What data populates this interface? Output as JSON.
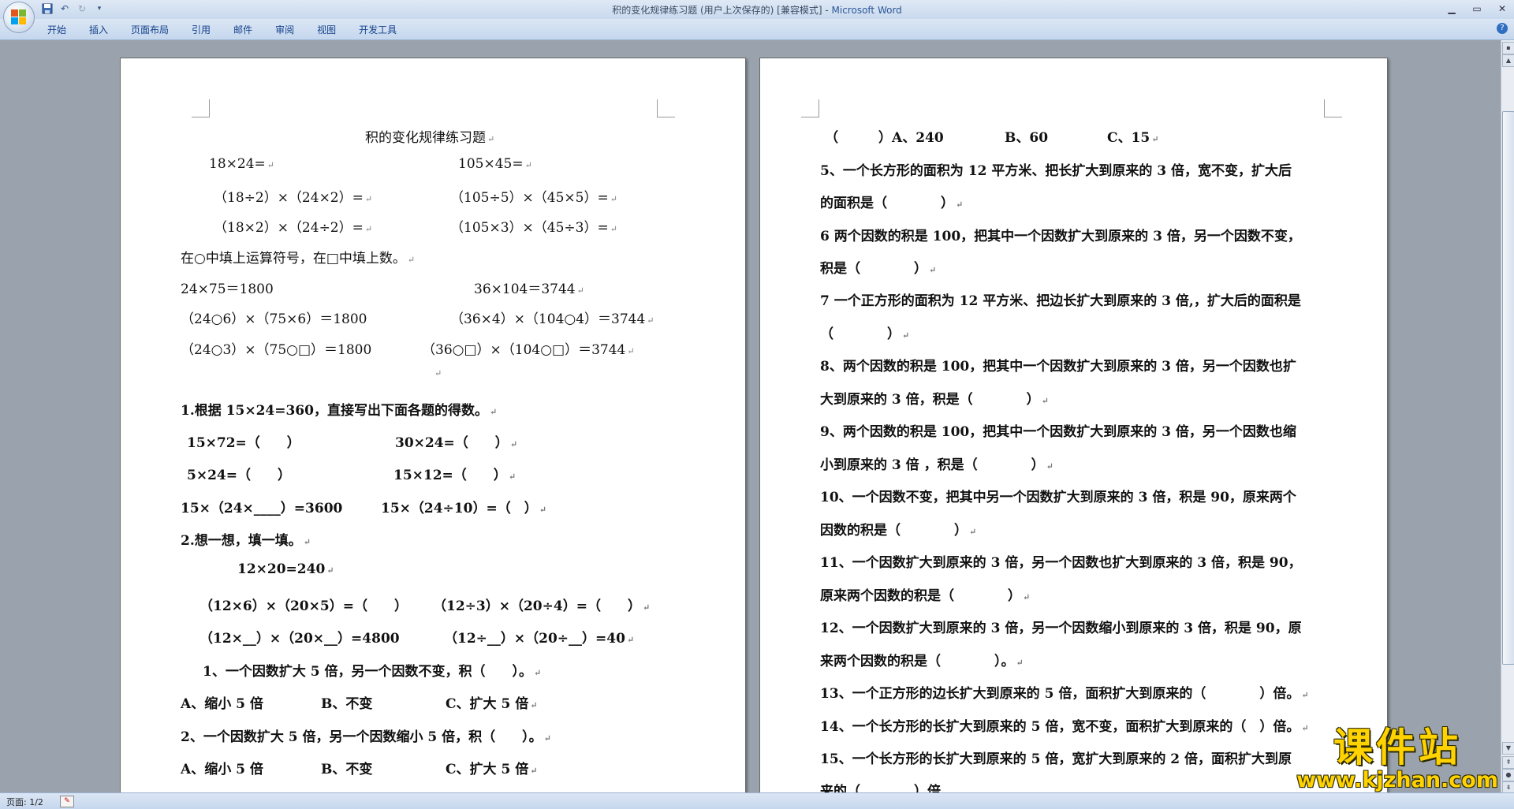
{
  "window": {
    "title": "积的变化规律练习题 (用户上次保存的) [兼容模式] - ",
    "app_name": "Microsoft Word"
  },
  "ribbon": {
    "tabs": [
      "开始",
      "插入",
      "页面布局",
      "引用",
      "邮件",
      "审阅",
      "视图",
      "开发工具"
    ]
  },
  "status": {
    "page": "页面: 1/2"
  },
  "watermark": {
    "title": "课件站",
    "url": "www.kjzhan.com"
  },
  "left_page": {
    "heading": "积的变化规律练习题",
    "line_a1": "18×24=",
    "line_a2": "105×45=",
    "line_b1": "（18÷2）×（24×2）=",
    "line_b2": "（105÷5）×（45×5）=",
    "line_c1": "（18×2）×（24÷2）=",
    "line_c2": "（105×3）×（45÷3）=",
    "instr": "在○中填上运算符号，在□中填上数。",
    "line_d1": "24×75＝1800",
    "line_d2": "36×104＝3744",
    "line_e1": "（24○6）×（75×6）＝1800",
    "line_e2": "（36×4）×（104○4）＝3744",
    "line_f1": "（24○3）×（75○□）＝1800",
    "line_f2": "（36○□）×（104○□）＝3744",
    "q1": "1.根据 15×24=360，直接写出下面各题的得数。",
    "q1a": "15×72=（　　）",
    "q1b": "30×24=（　　）",
    "q1c": "5×24=（　　）",
    "q1d": "15×12=（　　）",
    "q1e": "15×（24×____）=3600",
    "q1f": "15×（24÷10）=（　）",
    "q2": "2.想一想，填一填。",
    "q2a": "12×20=240",
    "q2b": "（12×6）×（20×5）=（　　）",
    "q2c": "（12÷3）×（20÷4）=（　　）",
    "q2d": "（12×__）×（20×__）=4800",
    "q2e": "（12÷__）×（20÷__）=40",
    "q3": "1、一个因数扩大 5 倍，另一个因数不变，积（　　）。",
    "q3A": "A、缩小 5 倍",
    "q3B": "B、不变",
    "q3C": "C、扩大 5 倍",
    "q4": "2、一个因数扩大 5 倍，另一个因数缩小 5 倍，积（　　）。",
    "q4A": "A、缩小 5 倍",
    "q4B": "B、不变",
    "q4C": "C、扩大 5 倍"
  },
  "right_page": {
    "r0a": "（　　　）A、240",
    "r0b": "B、60",
    "r0c": "C、15",
    "r5a": "5、一个长方形的面积为 12 平方米、把长扩大到原来的 3 倍，宽不变，扩大后",
    "r5b": "的面积是（　　　　）",
    "r6a": "6 两个因数的积是 100，把其中一个因数扩大到原来的 3 倍，另一个因数不变，",
    "r6b": "积是（　　　　）",
    "r7a": "7 一个正方形的面积为 12 平方米、把边长扩大到原来的 3 倍,，扩大后的面积是",
    "r7b": "（　　　　）",
    "r8a": "8、两个因数的积是 100，把其中一个因数扩大到原来的 3 倍，另一个因数也扩",
    "r8b": "大到原来的 3 倍，积是（　　　　）",
    "r9a": "9、两个因数的积是 100，把其中一个因数扩大到原来的 3 倍，另一个因数也缩",
    "r9b": "小到原来的 3 倍 ，积是（　　　　）",
    "r10a": "10、一个因数不变，把其中另一个因数扩大到原来的 3 倍，积是 90，原来两个",
    "r10b": "因数的积是（　　　　）",
    "r11a": "11、一个因数扩大到原来的 3 倍，另一个因数也扩大到原来的 3 倍，积是 90，",
    "r11b": "原来两个因数的积是（　　　　）",
    "r12a": "12、一个因数扩大到原来的 3 倍，另一个因数缩小到原来的 3 倍，积是 90，原",
    "r12b": "来两个因数的积是（　　　　）。",
    "r13": "13、一个正方形的边长扩大到原来的 5 倍，面积扩大到原来的（　　　　）倍。",
    "r14": "14、一个长方形的长扩大到原来的 5 倍，宽不变，面积扩大到原来的（　）倍。",
    "r15a": "15、一个长方形的长扩大到原来的 5 倍，宽扩大到原来的 2 倍，面积扩大到原",
    "r15b": "来的（　　　　）倍"
  }
}
